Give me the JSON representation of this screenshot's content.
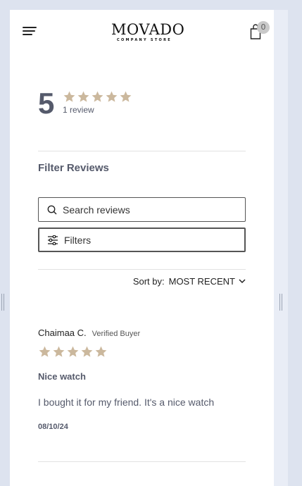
{
  "header": {
    "brand_name": "MOVADO",
    "brand_tagline": "COMPANY STORE",
    "cart_count": "0"
  },
  "summary": {
    "average": "5",
    "rating": 5,
    "review_count": "1 review"
  },
  "filter": {
    "heading": "Filter Reviews",
    "search_placeholder": "Search reviews",
    "filters_label": "Filters"
  },
  "sort": {
    "label": "Sort by:",
    "value": "MOST RECENT"
  },
  "reviews": [
    {
      "name": "Chaimaa C.",
      "badge": "Verified Buyer",
      "rating": 5,
      "title": "Nice watch",
      "body": "I bought it for my friend. It's a nice watch",
      "date": "08/10/24"
    }
  ],
  "colors": {
    "star": "#cbb89d",
    "text": "#555a6b",
    "background": "#dde3ef"
  }
}
